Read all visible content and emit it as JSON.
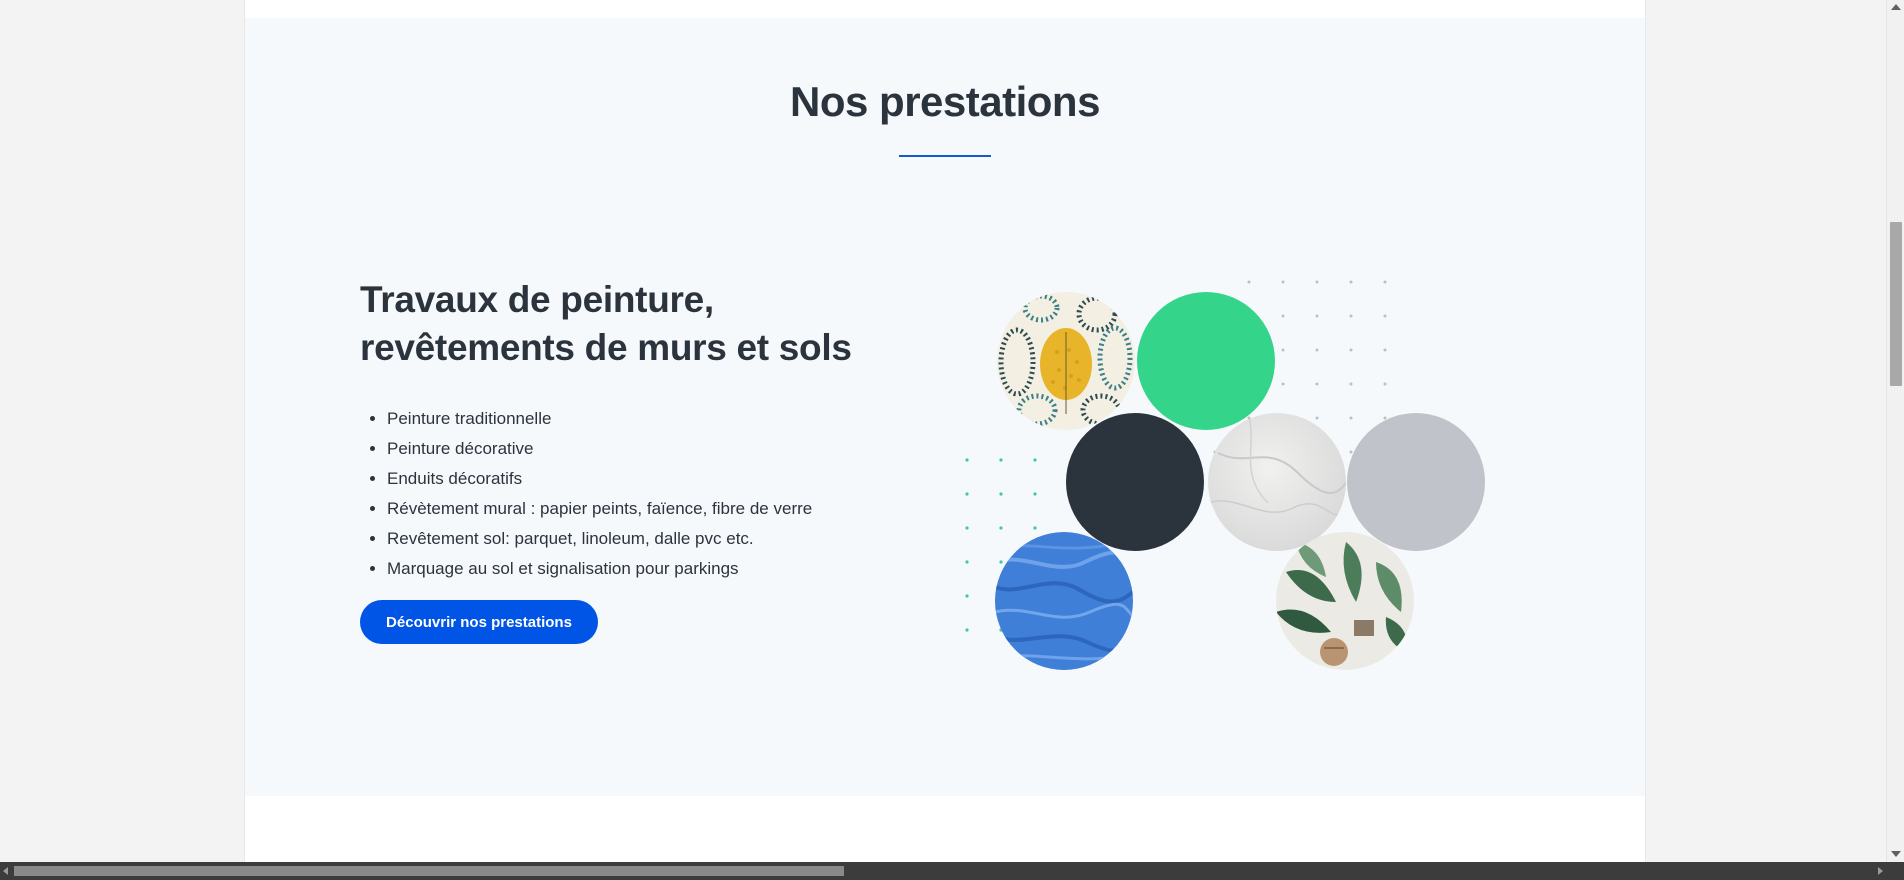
{
  "services": {
    "section_title": "Nos prestations",
    "heading": "Travaux de peinture, revêtements de murs et sols",
    "items": [
      "Peinture traditionnelle",
      "Peinture décorative",
      "Enduits décoratifs",
      "Révètement mural : papier peints, faïence, fibre de verre",
      "Revêtement sol: parquet, linoleum, dalle pvc etc.",
      "Marquage au sol et signalisation pour parkings"
    ],
    "cta_label": "Découvrir nos prestations"
  },
  "swatches": [
    {
      "name": "floral-wallpaper",
      "color": "#f3efe2"
    },
    {
      "name": "green",
      "color": "#34d58b"
    },
    {
      "name": "dark-slate",
      "color": "#2b333d"
    },
    {
      "name": "marble",
      "color": "#e2e2e2"
    },
    {
      "name": "light-grey",
      "color": "#c0c4ca"
    },
    {
      "name": "blue-paint-texture",
      "color": "#3f7fd8"
    },
    {
      "name": "tropical-wallpaper",
      "color": "#eceae4"
    }
  ],
  "colors": {
    "accent": "#0054e6",
    "underline": "#1558d6",
    "heading": "#2b333d",
    "section_background": "#f6f9fc",
    "dot_teal": "#3cc9a5",
    "dot_grey": "#b9c0c8"
  }
}
